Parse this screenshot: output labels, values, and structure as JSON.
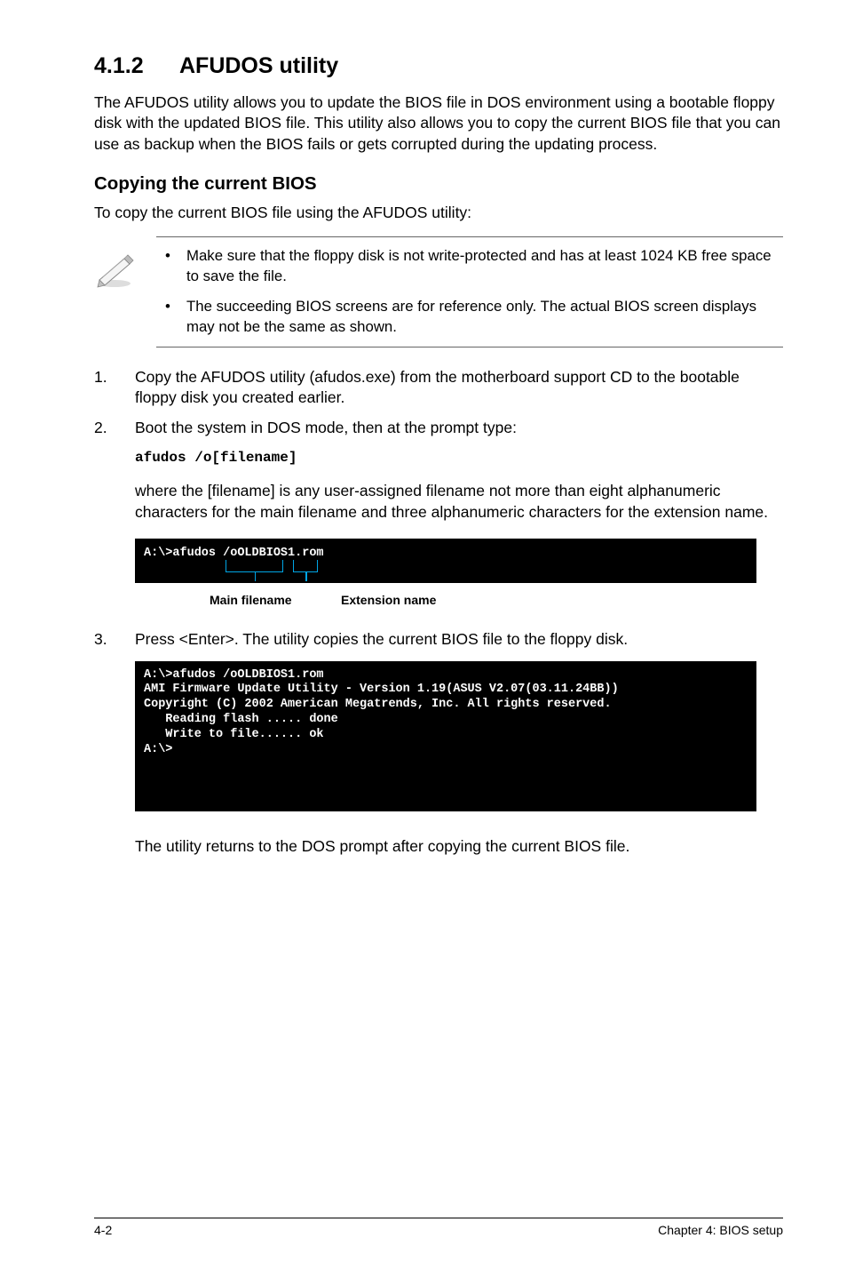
{
  "heading_num": "4.1.2",
  "heading_text": "AFUDOS utility",
  "intro": "The AFUDOS utility allows you to update the BIOS file in DOS environment using a bootable floppy disk with the updated BIOS file. This utility also allows you to copy the current BIOS file that you can use as backup when the BIOS fails or gets corrupted during the updating process.",
  "subhead": "Copying the current BIOS",
  "subline": "To copy the current BIOS file using the AFUDOS utility:",
  "note1": "Make sure that the floppy disk is not write-protected and has at least 1024 KB free space to save the file.",
  "note2": "The succeeding BIOS screens are for reference only. The actual BIOS screen displays may not be the same as shown.",
  "step1": "Copy the AFUDOS utility (afudos.exe) from the motherboard support CD to the bootable floppy disk you created earlier.",
  "step2": "Boot the system in DOS mode, then at the prompt type:",
  "cmd": "afudos /o[filename]",
  "step2b": "where the [filename] is any user-assigned filename not more than eight alphanumeric characters  for the main filename and three alphanumeric characters for the extension name.",
  "term1": "A:\\>afudos /oOLDBIOS1.rom",
  "cap_main": "Main filename",
  "cap_ext": "Extension name",
  "step3": "Press <Enter>. The utility copies the current BIOS file to the floppy disk.",
  "term2": "A:\\>afudos /oOLDBIOS1.rom\nAMI Firmware Update Utility - Version 1.19(ASUS V2.07(03.11.24BB))\nCopyright (C) 2002 American Megatrends, Inc. All rights reserved.\n   Reading flash ..... done\n   Write to file...... ok\nA:\\>",
  "closing": "The utility returns to the DOS prompt after copying the current BIOS file.",
  "footer_left": "4-2",
  "footer_right": "Chapter 4: BIOS setup"
}
